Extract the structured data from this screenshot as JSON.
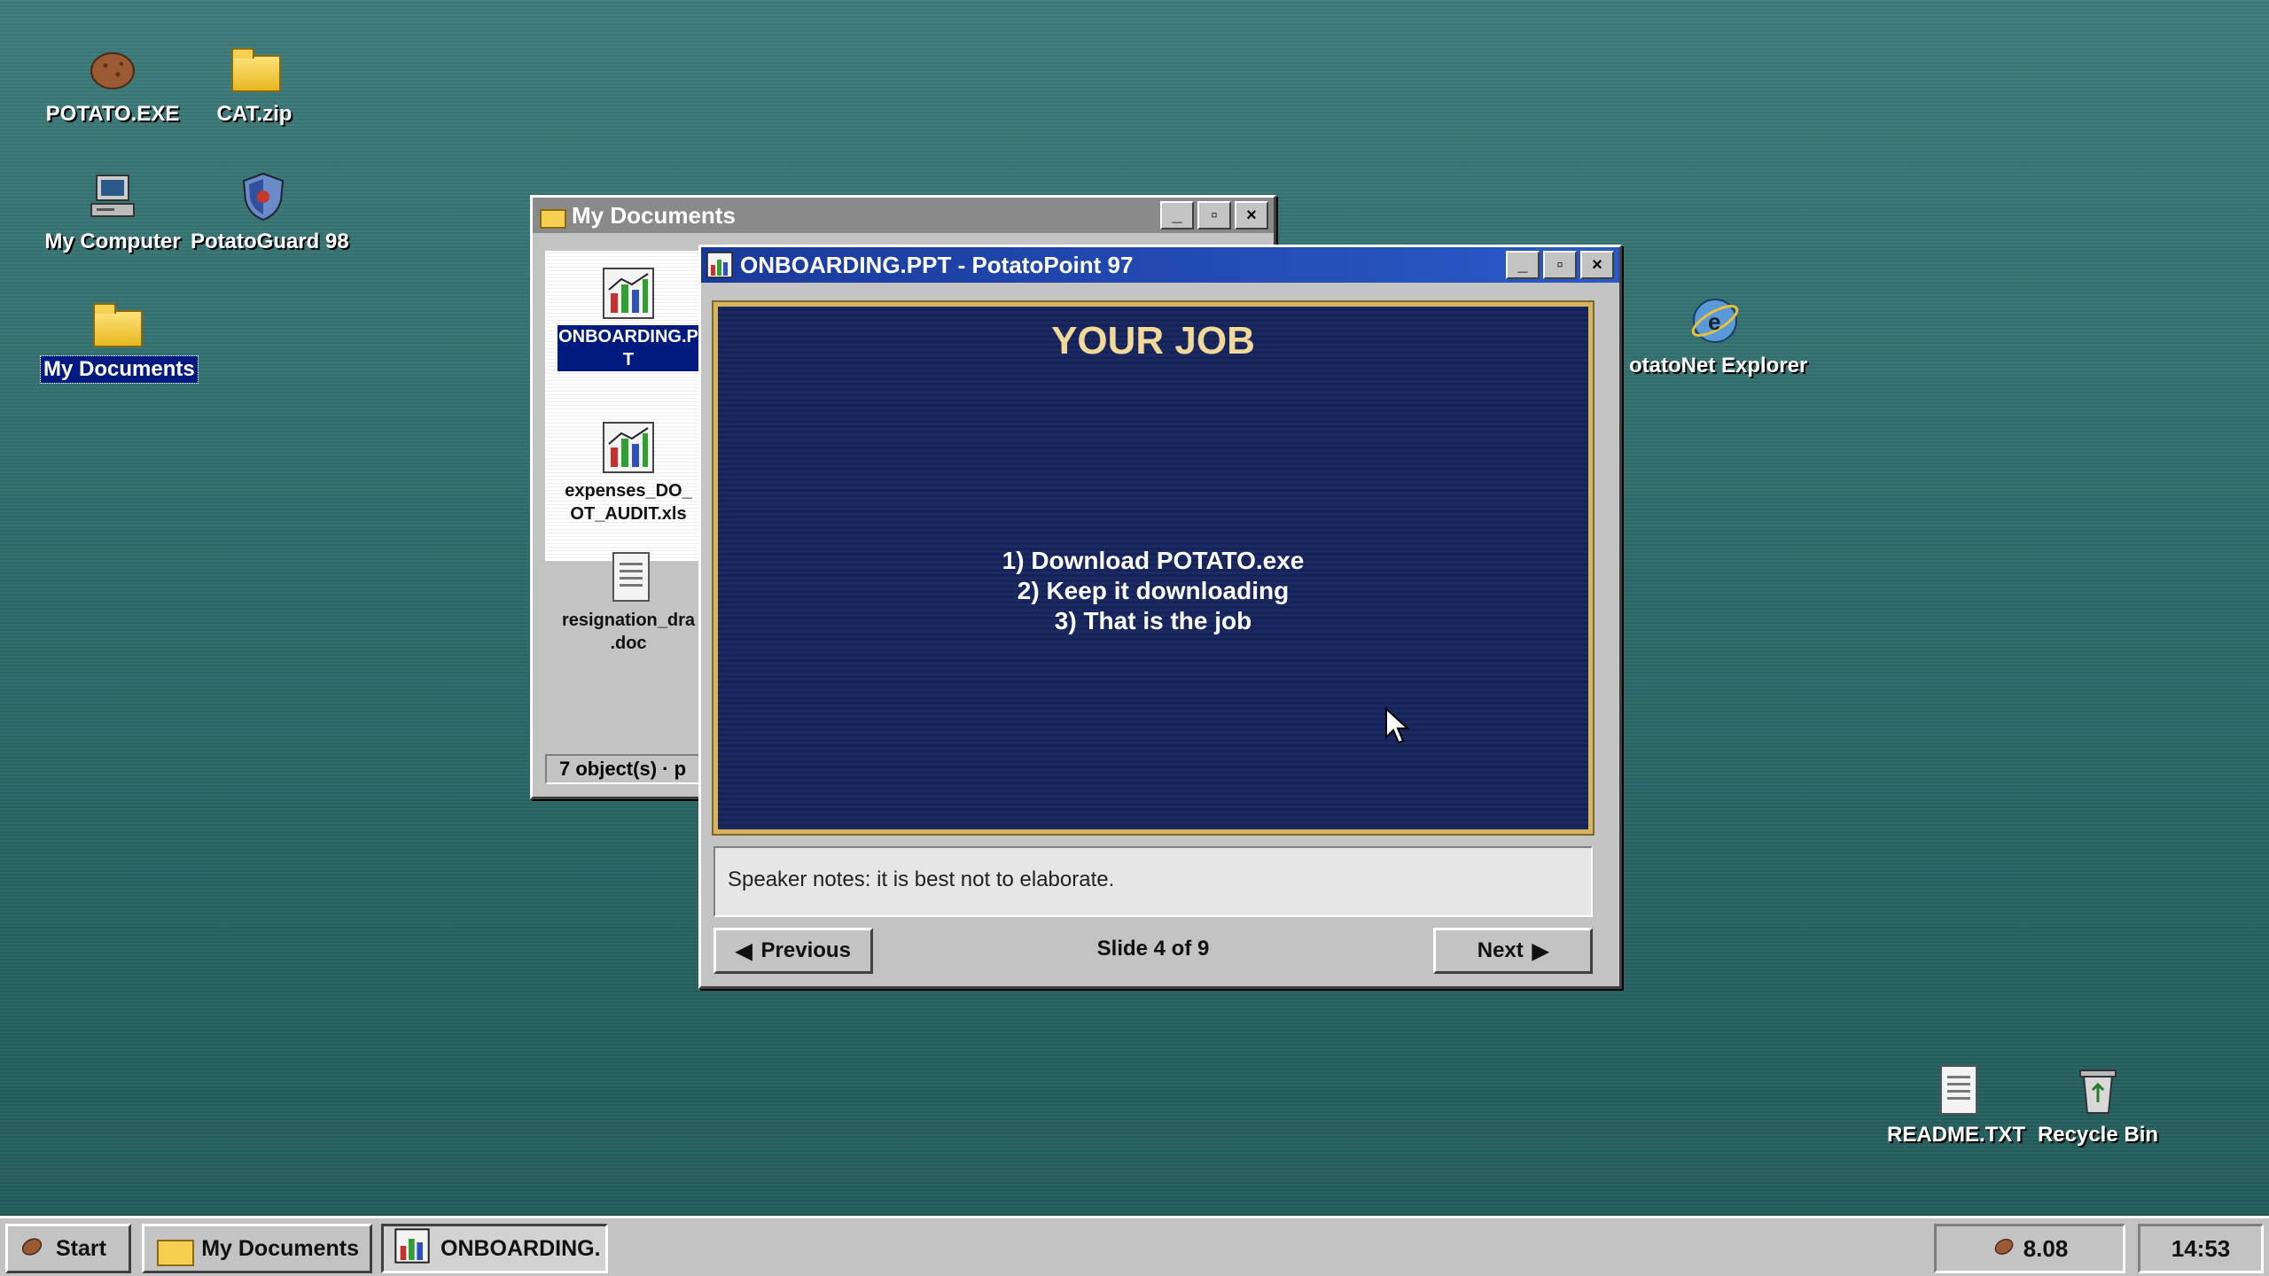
{
  "desktop": {
    "icons": [
      {
        "label": "POTATO.EXE",
        "icon": "potato-icon"
      },
      {
        "label": "CAT.zip",
        "icon": "folder-zip-icon"
      },
      {
        "label": "My Computer",
        "icon": "computer-icon"
      },
      {
        "label": "PotatoGuard 98",
        "icon": "shield-icon"
      },
      {
        "label": "My Documents",
        "icon": "folder-icon",
        "selected": true
      },
      {
        "label": "otatoNet Explorer",
        "icon": "browser-globe-icon"
      },
      {
        "label": "README.TXT",
        "icon": "text-file-icon"
      },
      {
        "label": "Recycle Bin",
        "icon": "recycle-bin-icon"
      }
    ]
  },
  "explorer": {
    "title": "My Documents",
    "files": [
      {
        "label": "ONBOARDING.PPT",
        "display": "ONBOARDING.P\nT",
        "icon": "presentation-chart-icon",
        "selected": true
      },
      {
        "label": "expenses_DO_NOT_AUDIT.xls",
        "display": "expenses_DO_\nOT_AUDIT.xls",
        "icon": "spreadsheet-chart-icon"
      },
      {
        "label": "resignation_draft.doc",
        "display": "resignation_dra\n.doc",
        "icon": "document-icon"
      }
    ],
    "status": "7 object(s) · p"
  },
  "ppt": {
    "title": "ONBOARDING.PPT - PotatoPoint 97",
    "slide_title": "YOUR JOB",
    "bullets": [
      "1) Download POTATO.exe",
      "2) Keep it downloading",
      "3) That is the job"
    ],
    "notes": "Speaker notes:  it is best not to elaborate.",
    "prev_label": "Previous",
    "next_label": "Next",
    "slide_indicator": "Slide 4 of 9"
  },
  "window_controls": {
    "minimize": "_",
    "maximize": "▫",
    "close": "×"
  },
  "taskbar": {
    "start_label": "Start",
    "tasks": [
      {
        "label": "My Documents",
        "icon": "folder-icon"
      },
      {
        "label": "ONBOARDING.",
        "icon": "presentation-chart-icon"
      }
    ],
    "tray_value": "8.08",
    "clock": "14:53"
  },
  "colors": {
    "title_active": "#1a3a9a",
    "title_inactive": "#8a8a8a",
    "slide_bg": "#1b2a64",
    "slide_title": "#f2d99a",
    "desktop": "#2f6c6b"
  }
}
